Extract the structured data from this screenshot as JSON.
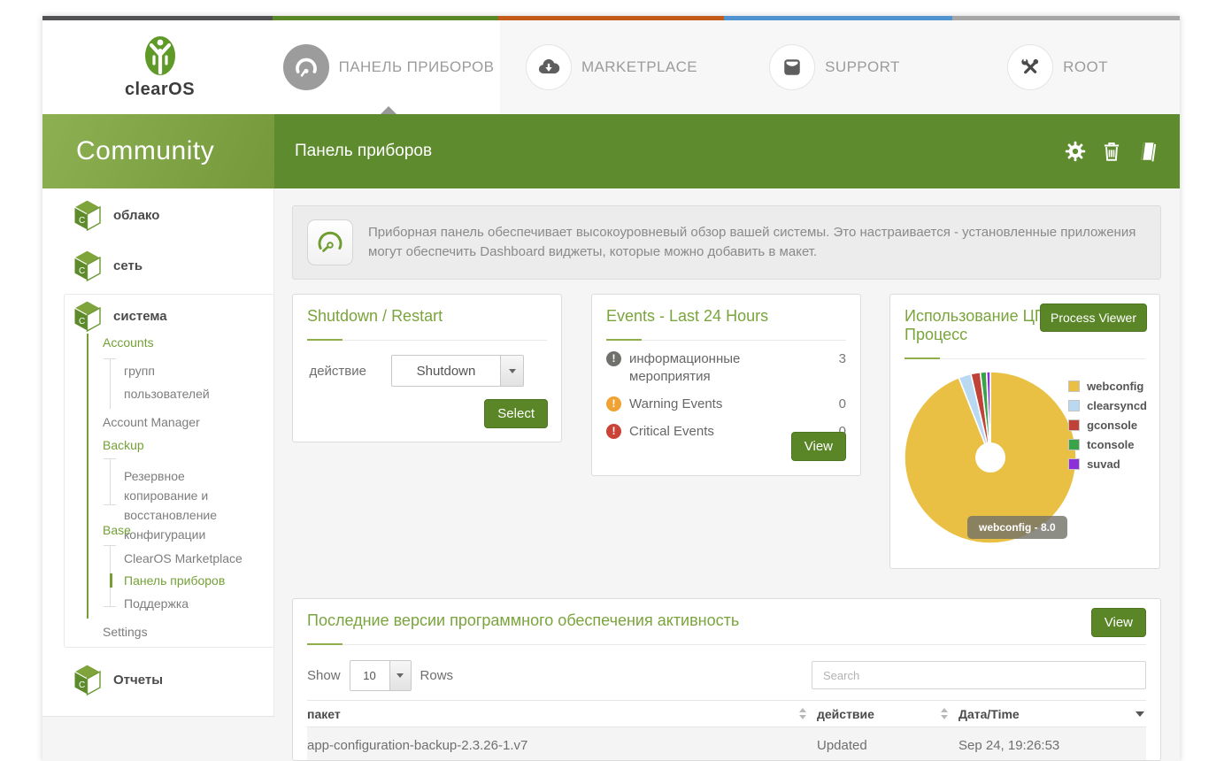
{
  "icons": {
    "dashboard-icon": "gauge",
    "marketplace-icon": "cloud-download",
    "support-icon": "inbox-box",
    "root-icon": "crossed-tools",
    "gear-icon": "gear",
    "trash-icon": "trash-can",
    "report-icon": "book",
    "app-cube-icon": "3d-cube",
    "banner-gauge-icon": "gauge",
    "info-icon": "exclamation-circle",
    "warning-icon": "exclamation-circle",
    "critical-icon": "exclamation-circle"
  },
  "strip_colors": [
    "#515153",
    "#5a8727",
    "#c35a17",
    "#4f94d1",
    "#a6a6a6"
  ],
  "topnav": {
    "brand": "clearOS",
    "tabs": [
      {
        "label": "ПАНЕЛЬ ПРИБОРОВ",
        "active": true
      },
      {
        "label": "MARKETPLACE",
        "active": false
      },
      {
        "label": "SUPPORT",
        "active": false
      },
      {
        "label": "ROOT",
        "active": false
      }
    ]
  },
  "header": {
    "edition": "Community",
    "page_title": "Панель приборов"
  },
  "sidebar": {
    "cloud": "облако",
    "network": "сеть",
    "system": "система",
    "reports": "Отчеты",
    "system_menu": {
      "accounts": "Accounts",
      "groups": "групп",
      "users": "пользователей",
      "account_manager": "Account Manager",
      "backup": "Backup",
      "config_backup": "Резервное копирование и восстановление конфигурации",
      "base": "Base",
      "marketplace": "ClearOS Marketplace",
      "dashboard": "Панель приборов",
      "support": "Поддержка",
      "settings": "Settings"
    }
  },
  "banner": {
    "text": "Приборная панель обеспечивает высокоуровневый обзор вашей системы. Это настраивается - установленные приложения могут обеспечить Dashboard виджеты, которые можно добавить в макет."
  },
  "shutdown_card": {
    "title": "Shutdown / Restart",
    "field_label": "действие",
    "select_value": "Shutdown",
    "button_label": "Select"
  },
  "events_card": {
    "title": "Events - Last 24 Hours",
    "button_label": "View",
    "rows": [
      {
        "label": "информационные мероприятия",
        "value": "3",
        "color": "#70706c"
      },
      {
        "label": "Warning Events",
        "value": "0",
        "color": "#f0a232"
      },
      {
        "label": "Critical Events",
        "value": "0",
        "color": "#cb4237"
      }
    ],
    "badge_glyph": "!"
  },
  "cpu_card": {
    "title": "Использование ЦП Процесс",
    "button_label": "Process Viewer",
    "tooltip": "webconfig - 8.0"
  },
  "chart_data": {
    "type": "pie",
    "title": "Использование ЦП Процесс",
    "labels": [
      "webconfig",
      "clearsyncd",
      "gconsole",
      "tconsole",
      "suvad"
    ],
    "values": [
      8.0,
      0.2,
      0.15,
      0.1,
      0.06
    ],
    "colors": [
      "#e9c044",
      "#b9d9f3",
      "#bf4138",
      "#3aa348",
      "#8c2fd8"
    ],
    "donut": true,
    "hole_color": "#ffffff",
    "legend_position": "right",
    "selected_slice": "webconfig",
    "selected_value": "8.0"
  },
  "table_card": {
    "title": "Последние версии программного обеспечения активность",
    "button_label": "View",
    "show_label": "Show",
    "rows_label": "Rows",
    "page_size": "10",
    "search_placeholder": "Search",
    "columns": [
      "пакет",
      "действие",
      "Дата/Time"
    ],
    "rows": [
      {
        "package": "app-configuration-backup-2.3.26-1.v7",
        "action": "Updated",
        "datetime": "Sep 24, 19:26:53"
      }
    ]
  }
}
